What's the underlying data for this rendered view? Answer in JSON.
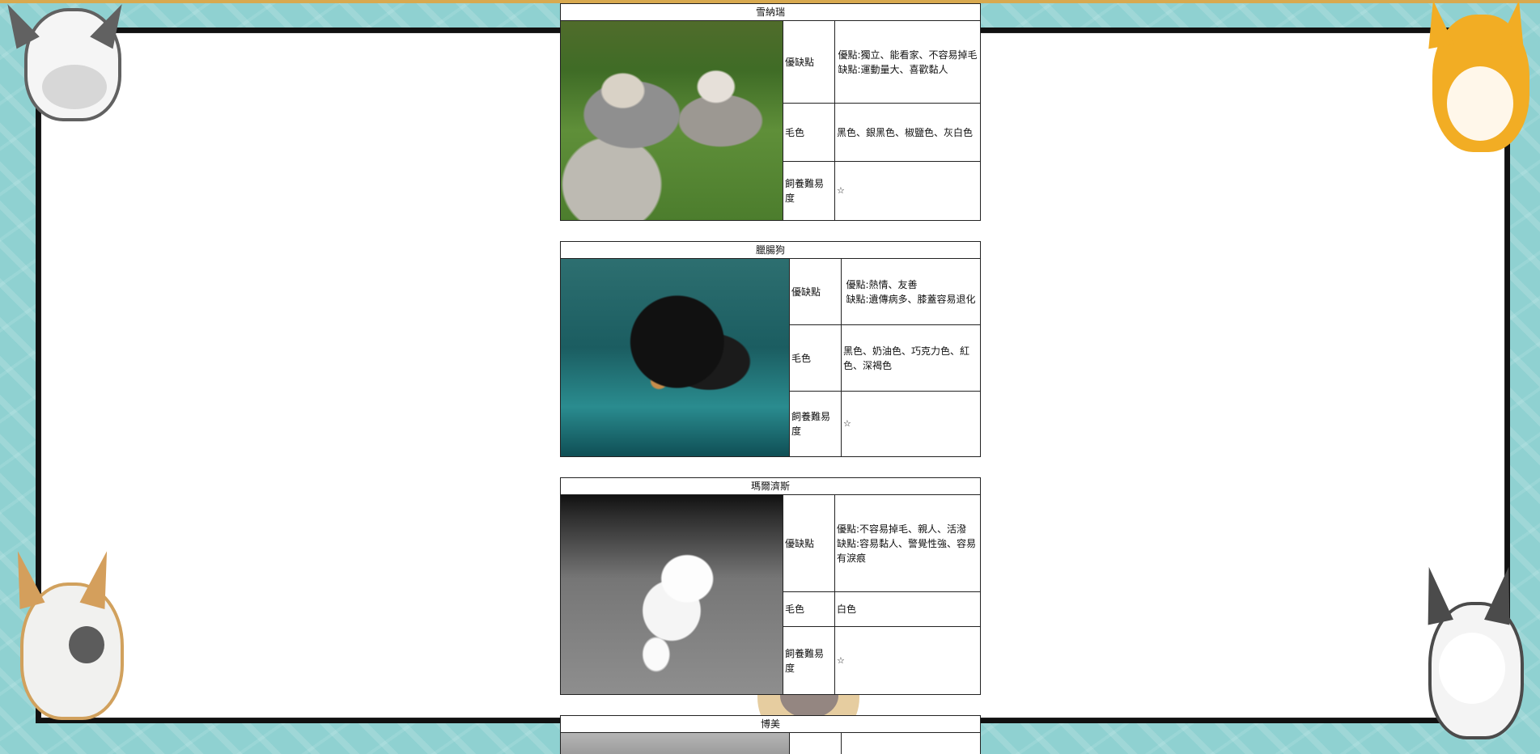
{
  "page": {
    "background_color": "#8fd1d1",
    "frame_color": "#111111",
    "accent_color": "#d8a94f"
  },
  "cards": [
    {
      "title": "雪納瑞",
      "image_alt": "schnauzer",
      "rows": [
        {
          "label": "優缺點",
          "value": "優點:獨立、能看家、不容易掉毛\n缺點:運動量大、喜歡黏人"
        },
        {
          "label": "毛色",
          "value": "黑色、銀黑色、椒鹽色、灰白色"
        },
        {
          "label": "飼養難易度",
          "value": "☆"
        }
      ]
    },
    {
      "title": "臘腸狗",
      "image_alt": "dachshund",
      "rows": [
        {
          "label": "優缺點",
          "value": "優點:熱情、友善\n缺點:遺傳病多、膝蓋容易退化"
        },
        {
          "label": "毛色",
          "value": "黑色、奶油色、巧克力色、紅色、深褐色"
        },
        {
          "label": "飼養難易度",
          "value": "☆"
        }
      ]
    },
    {
      "title": "瑪爾濟斯",
      "image_alt": "maltese",
      "rows": [
        {
          "label": "優缺點",
          "value": "優點:不容易掉毛、親人、活潑\n缺點:容易黏人、警覺性強、容易有淚痕"
        },
        {
          "label": "毛色",
          "value": "白色"
        },
        {
          "label": "飼養難易度",
          "value": "☆"
        }
      ]
    },
    {
      "title": "博美",
      "image_alt": "pomeranian",
      "rows": []
    }
  ],
  "decorations": {
    "top_left": "schnauzer-cartoon",
    "top_right": "shiba-cartoon",
    "bottom_left": "corgi-cartoon",
    "bottom_right": "husky-cartoon",
    "center_top": "corgi-cartoon",
    "center_bottom": "pug-cartoon"
  }
}
